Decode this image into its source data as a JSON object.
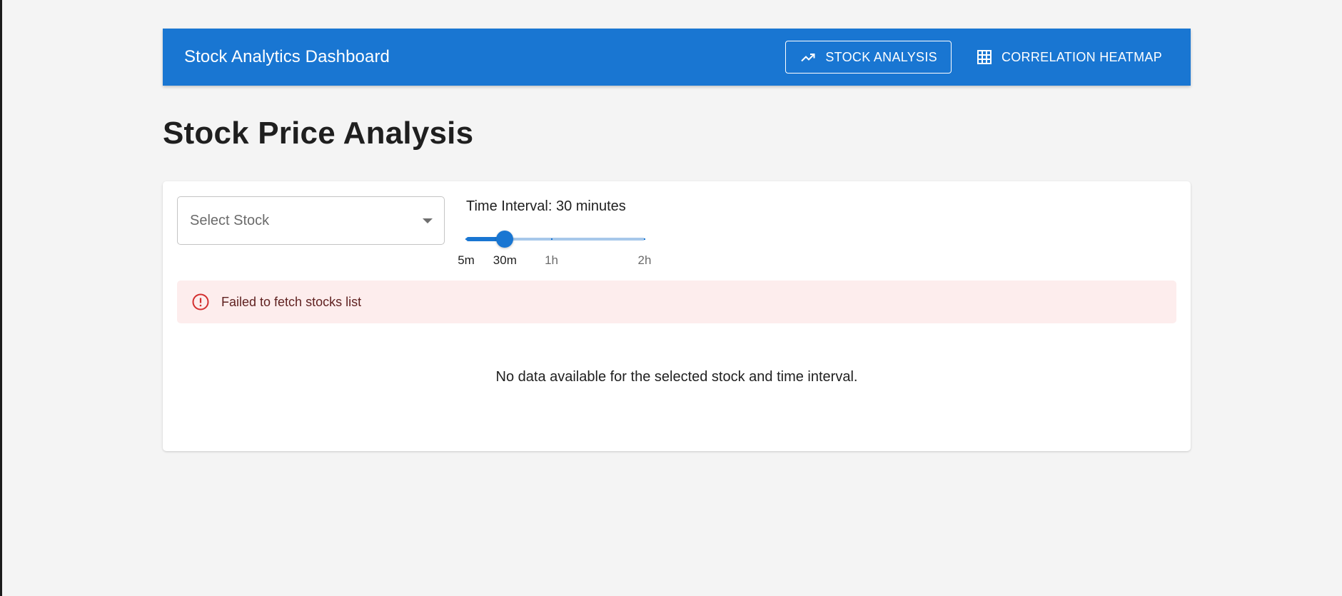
{
  "appbar": {
    "title": "Stock Analytics Dashboard",
    "accent_color": "#1976d2",
    "nav": [
      {
        "label": "STOCK ANALYSIS",
        "icon": "trending-up-icon",
        "active": true
      },
      {
        "label": "CORRELATION HEATMAP",
        "icon": "grid-icon",
        "active": false
      }
    ]
  },
  "page": {
    "title": "Stock Price Analysis"
  },
  "controls": {
    "stock_select": {
      "placeholder": "Select Stock",
      "value": ""
    },
    "interval": {
      "label": "Time Interval: 30 minutes",
      "value_minutes": 30,
      "min_minutes": 5,
      "max_minutes": 120,
      "marks": [
        {
          "label": "5m",
          "minutes": 5
        },
        {
          "label": "30m",
          "minutes": 30
        },
        {
          "label": "1h",
          "minutes": 60
        },
        {
          "label": "2h",
          "minutes": 120
        }
      ]
    }
  },
  "alert": {
    "severity": "error",
    "icon": "error-outline-icon",
    "message": "Failed to fetch stocks list",
    "color": "#d32f2f"
  },
  "empty_state": {
    "message": "No data available for the selected stock and time interval."
  }
}
